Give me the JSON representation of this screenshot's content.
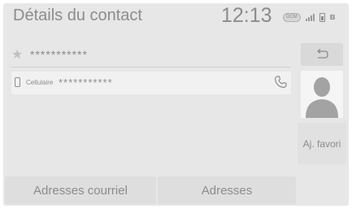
{
  "header": {
    "title": "Détails du contact",
    "time": "12:13",
    "status": {
      "badge": "DCM",
      "signal_icon": "signal-bars-icon",
      "battery_icon": "battery-icon",
      "bluetooth_icon": "bluetooth-icon"
    }
  },
  "contact": {
    "name": "***********",
    "favorite_icon": "star-icon"
  },
  "phone": {
    "type_label": "Cellulaire",
    "number": "***********",
    "device_icon": "mobile-phone-icon",
    "call_icon": "phone-handset-icon"
  },
  "side": {
    "back_icon": "return-arrow-icon",
    "avatar_icon": "person-silhouette-icon",
    "favorite_label": "Aj. favori"
  },
  "bottom": {
    "email_label": "Adresses courriel",
    "address_label": "Adresses"
  },
  "colors": {
    "background": "#e7e7e7",
    "text": "#8c8c8c",
    "button": "#dedede"
  }
}
